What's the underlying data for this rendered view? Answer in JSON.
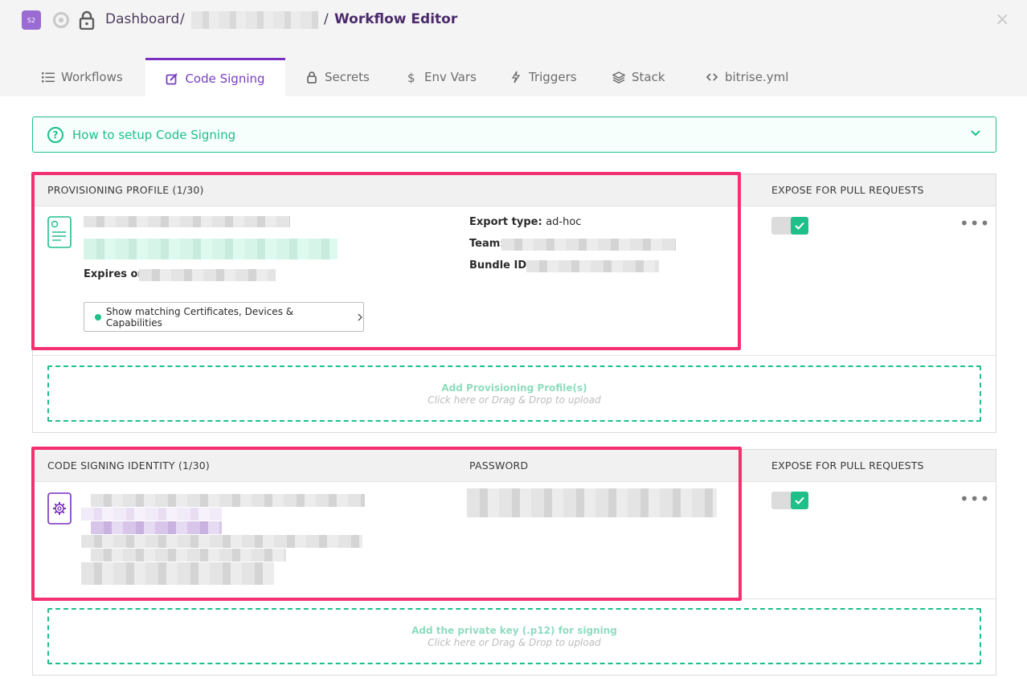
{
  "header": {
    "app_badge": "S2",
    "breadcrumb_root": "Dashboard",
    "separator": "/",
    "current_page": "Workflow Editor",
    "close_glyph": "×"
  },
  "tabs": [
    {
      "label": "Workflows",
      "icon": "list-icon"
    },
    {
      "label": "Code Signing",
      "icon": "edit-icon"
    },
    {
      "label": "Secrets",
      "icon": "lock-icon"
    },
    {
      "label": "Env Vars",
      "icon": "dollar-icon"
    },
    {
      "label": "Triggers",
      "icon": "bolt-icon"
    },
    {
      "label": "Stack",
      "icon": "layers-icon"
    },
    {
      "label": "bitrise.yml",
      "icon": "code-icon"
    }
  ],
  "howto": {
    "q_glyph": "?",
    "label": "How to setup Code Signing"
  },
  "provisioning": {
    "heading": "PROVISIONING PROFILE (1/30)",
    "expose_heading": "EXPOSE FOR PULL REQUESTS",
    "expires_label": "Expires on:",
    "export_type_label": "Export type:",
    "export_type_value": "ad-hoc",
    "team_label": "Team:",
    "bundle_id_label": "Bundle ID:",
    "match_button": "Show matching Certificates, Devices & Capabilities",
    "expose_enabled": true,
    "more_glyph": "•••",
    "drop_title": "Add Provisioning Profile(s)",
    "drop_hint": "Click here or Drag & Drop to upload"
  },
  "identity": {
    "heading": "CODE SIGNING IDENTITY (1/30)",
    "password_heading": "PASSWORD",
    "expose_heading": "EXPOSE FOR PULL REQUESTS",
    "expose_enabled": true,
    "more_glyph": "•••",
    "drop_title": "Add the private key (.p12) for signing",
    "drop_hint": "Click here or Drag & Drop to upload"
  },
  "colors": {
    "accent_purple": "#7a2fc0",
    "accent_green": "#1fbf8a",
    "highlight_pink": "#f43170"
  }
}
